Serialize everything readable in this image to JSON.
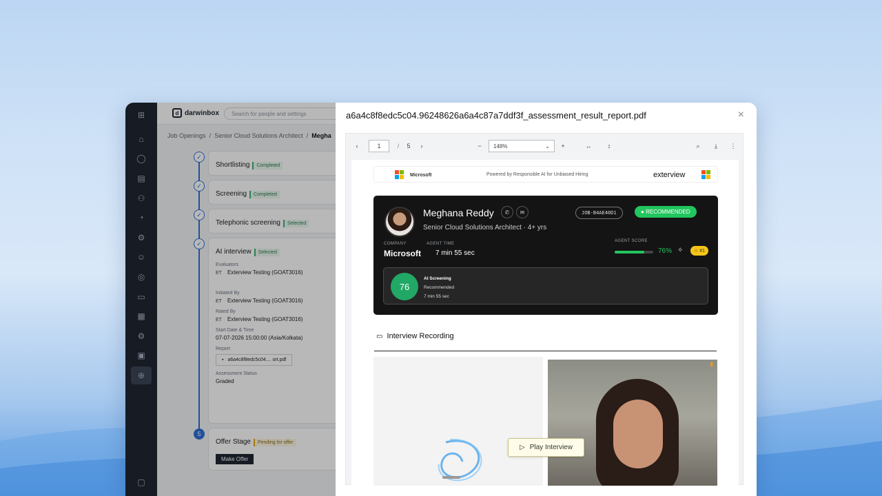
{
  "app": {
    "logo_text": "darwinbox",
    "search_placeholder": "Search for people and settings",
    "breadcrumb": [
      "Job Openings",
      "Senior Cloud Solutions Architect",
      "Megha"
    ],
    "breadcrumb_sep": "/",
    "rail_icons": [
      "grid-icon",
      "home-icon",
      "profile-icon",
      "doc-icon",
      "org-icon",
      "pie-icon",
      "people-sliders-icon",
      "team-icon",
      "coins-icon",
      "id-card-icon",
      "calendar-icon",
      "person-gear-icon",
      "image-icon",
      "search-people-icon",
      "d-icon"
    ],
    "stages": [
      {
        "title": "Shortlisting",
        "tag": "Completed"
      },
      {
        "title": "Screening",
        "tag": "Completed"
      },
      {
        "title": "Telephonic screening",
        "tag": "Selected"
      },
      {
        "title": "AI interview",
        "tag": "Selected"
      }
    ],
    "ai_interview": {
      "evaluators_label": "Evaluators",
      "evaluator": "Exterview Testing (GOAT3016)",
      "initials": "ET",
      "initiated_label": "Initiated By",
      "initiated": "Exterview Testing (GOAT3016)",
      "rated_label": "Rated By",
      "rated": "Exterview Testing (GOAT3016)",
      "start_label": "Start Date & Time",
      "start": "07-07-2026 15:00:00 (Asia/Kolkata)",
      "report_label": "Report",
      "report_file": "a6a4c8f8edc5c04.... ort.pdf",
      "assessment_label": "Assessment Status",
      "assessment": "Graded"
    },
    "offer": {
      "step": "5",
      "title": "Offer Stage",
      "tag": "Pending for offer",
      "button": "Make Offer"
    }
  },
  "modal": {
    "title": "a6a4c8f8edc5c04.96248626a6a4c87a7ddf3f_assessment_result_report.pdf",
    "close": "×"
  },
  "viewer": {
    "page": "1",
    "page_sep": "/",
    "total_pages": "5",
    "zoom": "148%"
  },
  "report": {
    "header_brand": "Microsoft",
    "header_tagline": "Powered by Responsible AI for Unbiased Hiring",
    "header_logo": "exterview",
    "name": "Meghana Reddy",
    "role": "Senior Cloud Solutions Architect · 4+ yrs",
    "job_id": "JOB-B4AE40D1",
    "recommendation": "RECOMMENDED",
    "company_label": "COMPANY",
    "company": "Microsoft",
    "agent_time_label": "AGENT TIME",
    "agent_time": "7 min 55 sec",
    "agent_score_label": "AGENT SCORE",
    "agent_score_pct": "76%",
    "agent_score_fraction": 0.76,
    "rank": "#1",
    "screening_score": "76",
    "screening_title": "AI Screening",
    "screening_status": "Recommended",
    "screening_time": "7 min 55 sec",
    "recording_title": "Interview Recording",
    "play_label": "Play Interview"
  },
  "colors": {
    "accent_blue": "#2f6fd6",
    "recommended_green": "#22c55e",
    "dark_card": "#141414"
  }
}
